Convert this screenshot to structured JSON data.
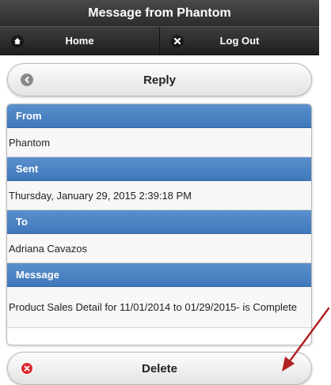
{
  "header": {
    "title": "Message from Phantom"
  },
  "nav": {
    "home_label": "Home",
    "logout_label": "Log Out"
  },
  "actions": {
    "reply_label": "Reply",
    "delete_label": "Delete"
  },
  "fields": [
    {
      "label": "From",
      "value": "Phantom"
    },
    {
      "label": "Sent",
      "value": "Thursday, January 29, 2015 2:39:18 PM"
    },
    {
      "label": "To",
      "value": "Adriana Cavazos"
    },
    {
      "label": "Message",
      "value": "Product Sales Detail for 11/01/2014 to 01/29/2015- is Complete"
    }
  ],
  "icons": {
    "home": "home-icon",
    "logout": "close-icon",
    "reply": "reply-icon",
    "delete": "delete-icon"
  },
  "colors": {
    "header": "#2f2f2f",
    "divider": "#4a82c3",
    "delete_icon": "#d9292d",
    "annotation_arrow": "#b22222"
  }
}
